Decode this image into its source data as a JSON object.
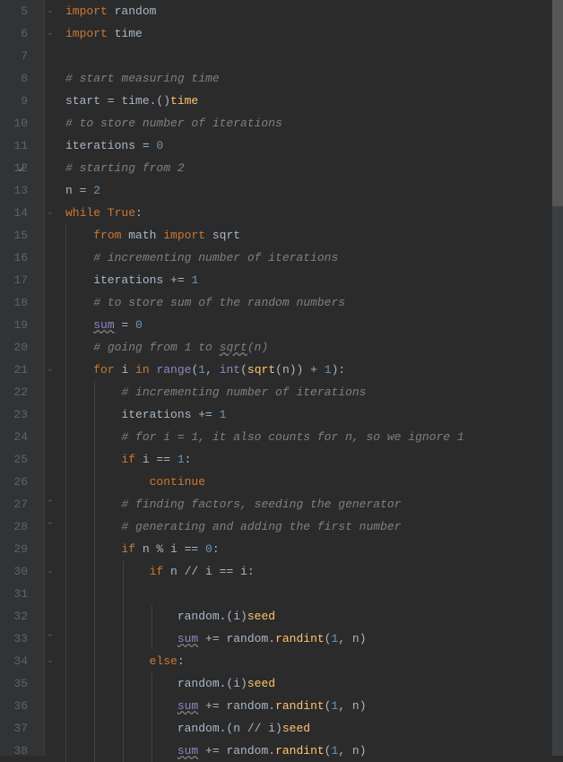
{
  "line_start": 5,
  "line_count": 34,
  "checkmark_line": 12,
  "code": {
    "l5": {
      "kw1": "import ",
      "t1": "random"
    },
    "l6": {
      "kw1": "import ",
      "t1": "time"
    },
    "l7": {},
    "l8": {
      "com": "# start measuring time"
    },
    "l9": {
      "t1": "start = time.",
      "fn": "time",
      "t2": "()"
    },
    "l10": {
      "com": "# to store number of iterations"
    },
    "l11": {
      "t1": "iterations = ",
      "num": "0"
    },
    "l12": {
      "com": "# starting from 2"
    },
    "l13": {
      "t1": "n = ",
      "num": "2"
    },
    "l14": {
      "kw1": "while True",
      "t1": ":"
    },
    "l15": {
      "kw1": "from ",
      "t1": "math ",
      "kw2": "import ",
      "t2": "sqrt"
    },
    "l16": {
      "com": "# incrementing number of iterations"
    },
    "l17": {
      "t1": "iterations += ",
      "num": "1"
    },
    "l18": {
      "com": "# to store sum of the random numbers"
    },
    "l19": {
      "bi": "sum",
      "t1": " = ",
      "num": "0"
    },
    "l20": {
      "com1": "# going from 1 to ",
      "warn": "sqrt",
      "com2": "(n)"
    },
    "l21": {
      "kw1": "for ",
      "t1": "i ",
      "kw2": "in ",
      "bi1": "range",
      "t2": "(",
      "num1": "1",
      "t3": ", ",
      "bi2": "int",
      "t4": "(",
      "fn": "sqrt",
      "t5": "(n)) + ",
      "num2": "1",
      "t6": "):"
    },
    "l22": {
      "com": "# incrementing number of iterations"
    },
    "l23": {
      "t1": "iterations += ",
      "num": "1"
    },
    "l24": {
      "com": "# for i = 1, it also counts for n, so we ignore 1"
    },
    "l25": {
      "kw1": "if ",
      "t1": "i == ",
      "num": "1",
      "t2": ":"
    },
    "l26": {
      "kw1": "continue"
    },
    "l27": {
      "com": "# finding factors, seeding the generator"
    },
    "l28": {
      "com": "# generating and adding the first number"
    },
    "l29": {
      "kw1": "if ",
      "t1": "n % i == ",
      "num": "0",
      "t2": ":"
    },
    "l30": {
      "kw1": "if ",
      "t1": "n // i == i:"
    },
    "l31": {},
    "l32": {
      "t1": "random.",
      "fn": "seed",
      "t2": "(i)"
    },
    "l33": {
      "bi": "sum",
      "t1": " += random.",
      "fn": "randint",
      "t2": "(",
      "num1": "1",
      "t3": ", n)"
    },
    "l34": {
      "kw1": "else",
      "t1": ":"
    },
    "l35": {
      "t1": "random.",
      "fn": "seed",
      "t2": "(i)"
    },
    "l36": {
      "bi": "sum",
      "t1": " += random.",
      "fn": "randint",
      "t2": "(",
      "num1": "1",
      "t3": ", n)"
    },
    "l37": {
      "t1": "random.",
      "fn": "seed",
      "t2": "(n // i)"
    },
    "l38": {
      "bi": "sum",
      "t1": " += random.",
      "fn": "randint",
      "t2": "(",
      "num1": "1",
      "t3": ", n)"
    }
  },
  "indents": {
    "l5": 0,
    "l6": 0,
    "l7": 0,
    "l8": 0,
    "l9": 0,
    "l10": 0,
    "l11": 0,
    "l12": 0,
    "l13": 0,
    "l14": 0,
    "l15": 1,
    "l16": 1,
    "l17": 1,
    "l18": 1,
    "l19": 1,
    "l20": 1,
    "l21": 1,
    "l22": 2,
    "l23": 2,
    "l24": 2,
    "l25": 2,
    "l26": 3,
    "l27": 2,
    "l28": 2,
    "l29": 2,
    "l30": 3,
    "l31": 0,
    "l32": 4,
    "l33": 4,
    "l34": 3,
    "l35": 4,
    "l36": 4,
    "l37": 4,
    "l38": 4
  }
}
